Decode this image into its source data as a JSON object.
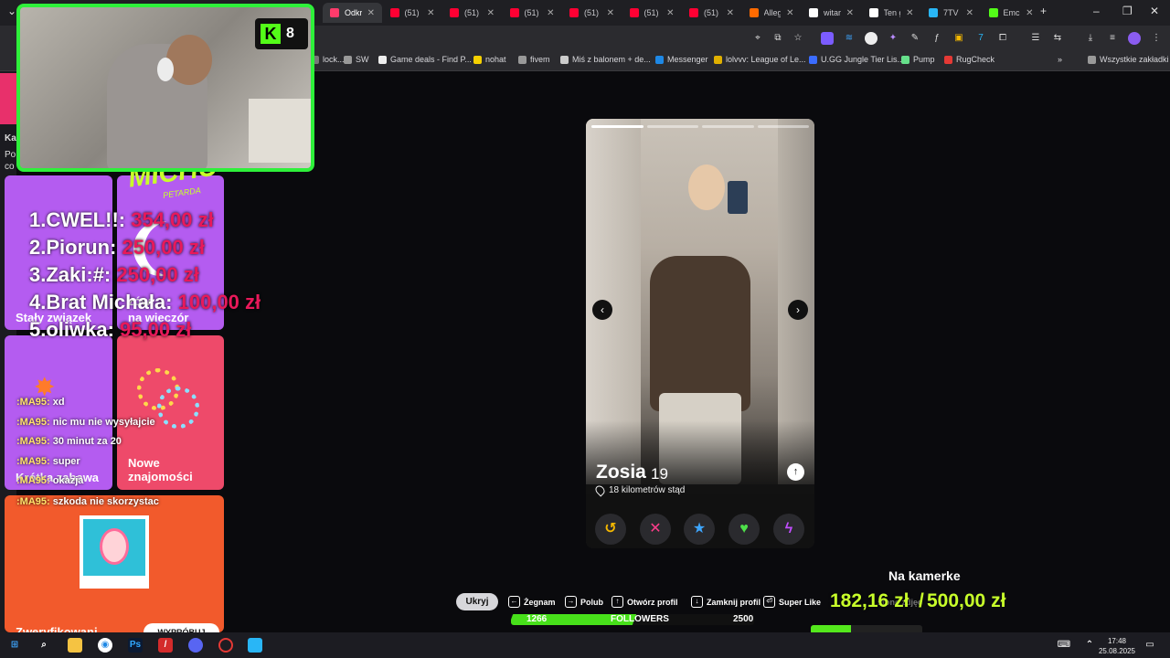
{
  "browser": {
    "tabs": [
      {
        "label": "Odkr",
        "color": "#ff3b6b",
        "active": true
      },
      {
        "label": "(51)",
        "color": "#ff0033"
      },
      {
        "label": "(51)",
        "color": "#ff0033"
      },
      {
        "label": "(51)",
        "color": "#ff0033"
      },
      {
        "label": "(51)",
        "color": "#ff0033"
      },
      {
        "label": "(51)",
        "color": "#ff0033"
      },
      {
        "label": "(51)",
        "color": "#ff0033"
      },
      {
        "label": "Alleg",
        "color": "#ff6a00"
      },
      {
        "label": "witar",
        "color": "#ffffff"
      },
      {
        "label": "Ten g",
        "color": "#ffffff"
      },
      {
        "label": "7TV",
        "color": "#29b6f6"
      },
      {
        "label": "Emc",
        "color": "#53fc18"
      }
    ],
    "bookmarks": [
      {
        "label": "lock...",
        "color": "#777"
      },
      {
        "label": "SW",
        "color": "#999"
      },
      {
        "label": "Game deals - Find P...",
        "color": "#eee"
      },
      {
        "label": "nohat",
        "color": "#f5d000"
      },
      {
        "label": "fivem",
        "color": "#999"
      },
      {
        "label": "Miś z balonem + de...",
        "color": "#ccc"
      },
      {
        "label": "Messenger",
        "color": "#1e88e5"
      },
      {
        "label": "lolvvv: League of Le...",
        "color": "#e0b000"
      },
      {
        "label": "U.GG Jungle Tier Lis...",
        "color": "#3b6cff"
      },
      {
        "label": "Pump",
        "color": "#66e08b"
      },
      {
        "label": "RugCheck",
        "color": "#e53935"
      },
      {
        "label": "Wszystkie zakładki",
        "color": "#999"
      }
    ]
  },
  "profile": {
    "name": "Zosia",
    "age": "19",
    "distance": "18 kilometrów stąd",
    "photos_total": 4,
    "photo_index": 1
  },
  "actions": [
    {
      "name": "rewind",
      "glyph": "↺",
      "color": "#f5b800"
    },
    {
      "name": "nope",
      "glyph": "✕",
      "color": "#ff3d8b"
    },
    {
      "name": "super-like",
      "glyph": "★",
      "color": "#3ea6ff"
    },
    {
      "name": "like",
      "glyph": "♥",
      "color": "#4ee04a"
    },
    {
      "name": "boost",
      "glyph": "ϟ",
      "color": "#c24dff"
    }
  ],
  "hints": {
    "hide": "Ukryj",
    "items": [
      {
        "key": "←",
        "label": "Żegnam"
      },
      {
        "key": "→",
        "label": "Polub"
      },
      {
        "key": "↑",
        "label": "Otwórz profil"
      },
      {
        "key": "↓",
        "label": "Zamknij profil"
      },
      {
        "key": "⏎",
        "label": "Super Like"
      }
    ]
  },
  "overlay": {
    "kick_viewers": "8",
    "logo": "MICHU",
    "logo_sub": "PETARDA",
    "left_text": [
      "Ka",
      "Po",
      "co"
    ],
    "donors": [
      {
        "name": "1.CWEL!!:",
        "amount": "354,00 zł"
      },
      {
        "name": "2.Piorun:",
        "amount": "250,00 zł"
      },
      {
        "name": "3.Zaki:#:",
        "amount": "250,00 zł"
      },
      {
        "name": "4.Brat Michała:",
        "amount": "100,00 zł"
      },
      {
        "name": "5.oliwka:",
        "amount": "95,00 zł"
      }
    ],
    "tiles": [
      {
        "label": "Stały związek",
        "color": "#b45cf0"
      },
      {
        "label": "na wieczór",
        "color": "#b45cf0"
      },
      {
        "label": "Krótka zabawa",
        "color": "#b45cf0"
      },
      {
        "label": "Nowe znajomości",
        "color": "#ee4a6a"
      },
      {
        "label": "Zweryfikowani",
        "color": "#f25a2c"
      }
    ],
    "tile_button": "WYPRÓBUJ",
    "tile_partial": "zów",
    "chat": [
      {
        "user": ":MA95:",
        "text": "xd"
      },
      {
        "user": ":MA95:",
        "text": "nic mu nie wysyłajcie"
      },
      {
        "user": ":MA95:",
        "text": "30 minut za 20"
      },
      {
        "user": ":MA95:",
        "text": "super"
      },
      {
        "user": ":MA95:",
        "text": "okazja"
      },
      {
        "user": ":MA95:",
        "text": "szkoda nie skorzystac"
      }
    ],
    "followers_current": "1266",
    "followers_label": "FOLLOWERS",
    "followers_goal": "2500",
    "followers_progress": 0.506,
    "camera_title": "Na kamerke",
    "camera_current": "182,16 zł",
    "camera_sep": "/",
    "camera_goal": "500,00 zł",
    "camera_progress": 0.364,
    "partial_hint": "stone zdjęc"
  },
  "taskbar": {
    "time": "17:48",
    "date": "25.08.2025"
  }
}
